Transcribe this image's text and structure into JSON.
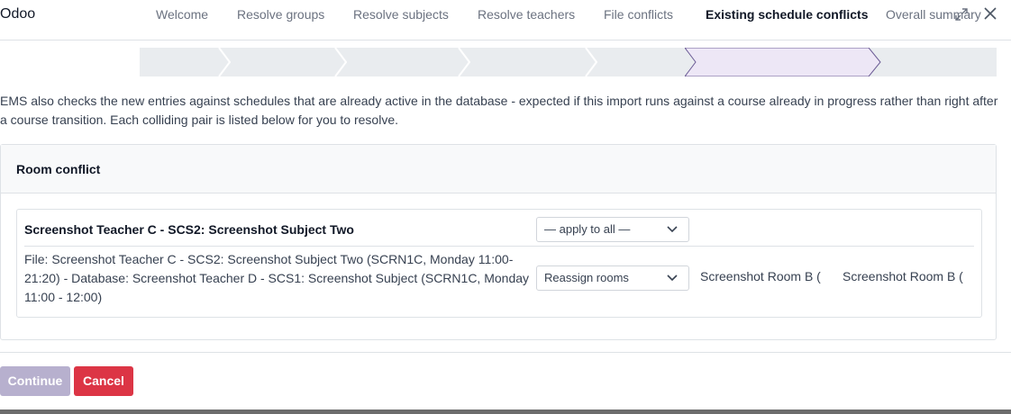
{
  "dialog": {
    "title": "Odoo"
  },
  "steps": [
    {
      "label": "Welcome",
      "active": false
    },
    {
      "label": "Resolve groups",
      "active": false
    },
    {
      "label": "Resolve subjects",
      "active": false
    },
    {
      "label": "Resolve teachers",
      "active": false
    },
    {
      "label": "File conflicts",
      "active": false
    },
    {
      "label": "Existing schedule conflicts",
      "active": true
    },
    {
      "label": "Overall summary",
      "active": false
    }
  ],
  "intro": "EMS also checks the new entries against schedules that are already active in the database - expected if this import runs against a course already in progress rather than right after a course transition. Each colliding pair is listed below for you to resolve.",
  "conflict_card": {
    "title": "Room conflict",
    "pair_title": "Screenshot Teacher C - SCS2: Screenshot Subject Two",
    "apply_all_select": "— apply to all —",
    "pair_description": "File: Screenshot Teacher C - SCS2: Screenshot Subject Two (SCRN1C, Monday 11:00-21:20) - Database: Screenshot Teacher D - SCS1: Screenshot Subject (SCRN1C, Monday 11:00 - 12:00)",
    "action_select": "Reassign rooms",
    "room_a": "Screenshot Room B (",
    "room_b": "Screenshot Room B ("
  },
  "footer": {
    "continue_label": "Continue",
    "cancel_label": "Cancel"
  },
  "colors": {
    "active_step_bg": "#ede7f6",
    "active_step_border": "#6b5b95",
    "continue_bg": "#b7b0ce",
    "cancel_bg": "#dc3545"
  }
}
